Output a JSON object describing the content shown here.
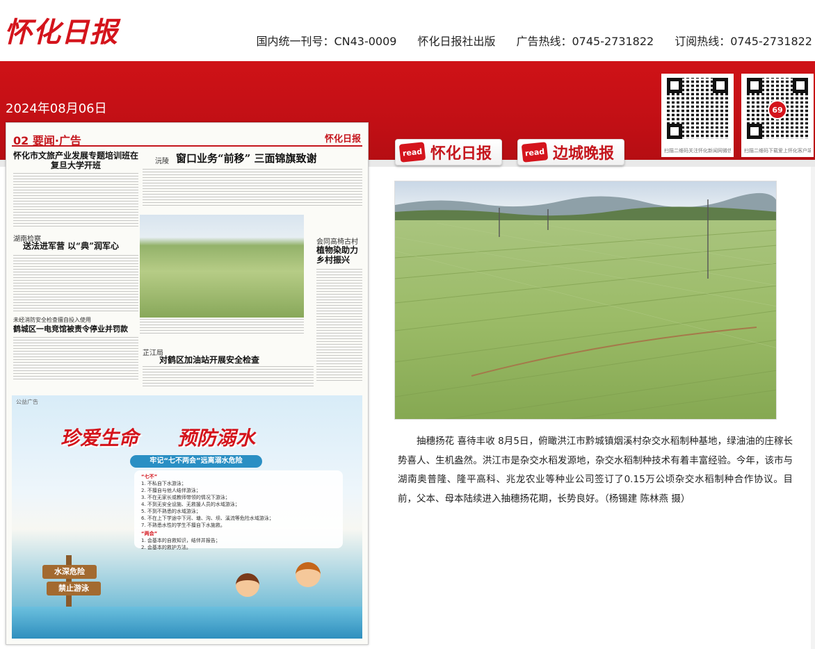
{
  "header": {
    "logo": "怀化日报",
    "info": [
      "国内统一刊号：CN43-0009",
      "怀化日报社出版",
      "广告热线：0745-2731822",
      "订阅热线：0745-2731822"
    ]
  },
  "date": "2024年08月06日",
  "qr_codes": [
    {
      "caption": "扫描二维码关注怀化新闻网微信公众号",
      "badge": ""
    },
    {
      "caption": "扫描二维码下载爱上怀化客户端",
      "badge": "69"
    }
  ],
  "page": {
    "section": "02 要闻·广告",
    "masthead": "怀化日报",
    "headlines": {
      "h1": "怀化市文旅产业发展专题培训班在复旦大学开班",
      "h2": "窗口业务“前移” 三面锦旗致谢",
      "h2_kicker": "沅陵",
      "h3": "送法进军营 以“典”润军心",
      "h3_kicker": "湖南检察",
      "h4": "植物染助力乡村振兴",
      "h4_kicker": "会同高椅古村",
      "h5": "鹤城区一电竞馆被责令停业并罚款",
      "h5_kicker": "未经消防安全检查擅自投入使用",
      "h6": "对鹤区加油站开展安全检查",
      "h6_kicker": "芷江局"
    },
    "poster": {
      "tag": "公益广告",
      "title_a": "珍爱生命",
      "title_b": "预防溺水",
      "banner": "牢记“七不两会”远离溺水危险",
      "seven_label": "“七不”",
      "seven": [
        "1. 不私自下水游泳；",
        "2. 不擅自与他人结伴游泳；",
        "3. 不在无家长或教师带领的情况下游泳；",
        "4. 不到无安全设施、无救援人员的水域游泳；",
        "5. 不到不熟悉的水域游泳；",
        "6. 不在上下学途中下河、塘、沟、坝、溪流等危险水域游泳；",
        "7. 不熟悉水性的学生不擅自下水施救。"
      ],
      "two_label": "“两会”",
      "two": [
        "1. 会基本的自救知识，结伴并报告；",
        "2. 会基本的救护方法。"
      ],
      "sign1": "水深危险",
      "sign2": "禁止游泳"
    }
  },
  "tabs": [
    {
      "icon": "read",
      "label": "怀化日报"
    },
    {
      "icon": "read",
      "label": "边城晚报"
    }
  ],
  "article": {
    "caption": "抽穗扬花 喜待丰收 8月5日，俯瞰洪江市黔城镇烟溪村杂交水稻制种基地，绿油油的庄稼长势喜人、生机盎然。洪江市是杂交水稻发源地，杂交水稻制种技术有着丰富经验。今年，该市与湖南奥普隆、隆平高科、兆龙农业等种业公司签订了0.15万公顷杂交水稻制种合作协议。目前，父本、母本陆续进入抽穗扬花期，长势良好。（杨锡建 陈林燕 摄）"
  },
  "colors": {
    "brand_red": "#d4141c",
    "band_red": "#c10f15"
  }
}
